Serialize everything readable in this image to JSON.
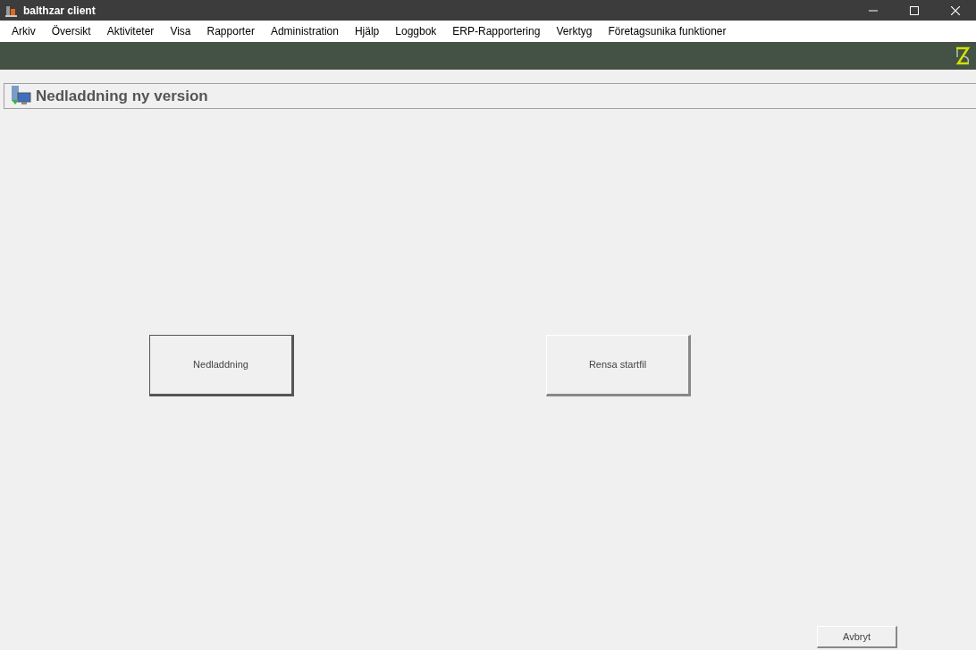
{
  "window": {
    "title": "balthzar client"
  },
  "menu": [
    "Arkiv",
    "Översikt",
    "Aktiviteter",
    "Visa",
    "Rapporter",
    "Administration",
    "Hjälp",
    "Loggbok",
    "ERP-Rapportering",
    "Verktyg",
    "Företagsunika funktioner"
  ],
  "panel": {
    "title": "Nedladdning ny version"
  },
  "actions": [
    {
      "label": "Nedladdning",
      "focused": true
    },
    {
      "label": "Rensa startfil",
      "focused": false
    }
  ],
  "footer_buttons": [
    "Avbryt"
  ]
}
